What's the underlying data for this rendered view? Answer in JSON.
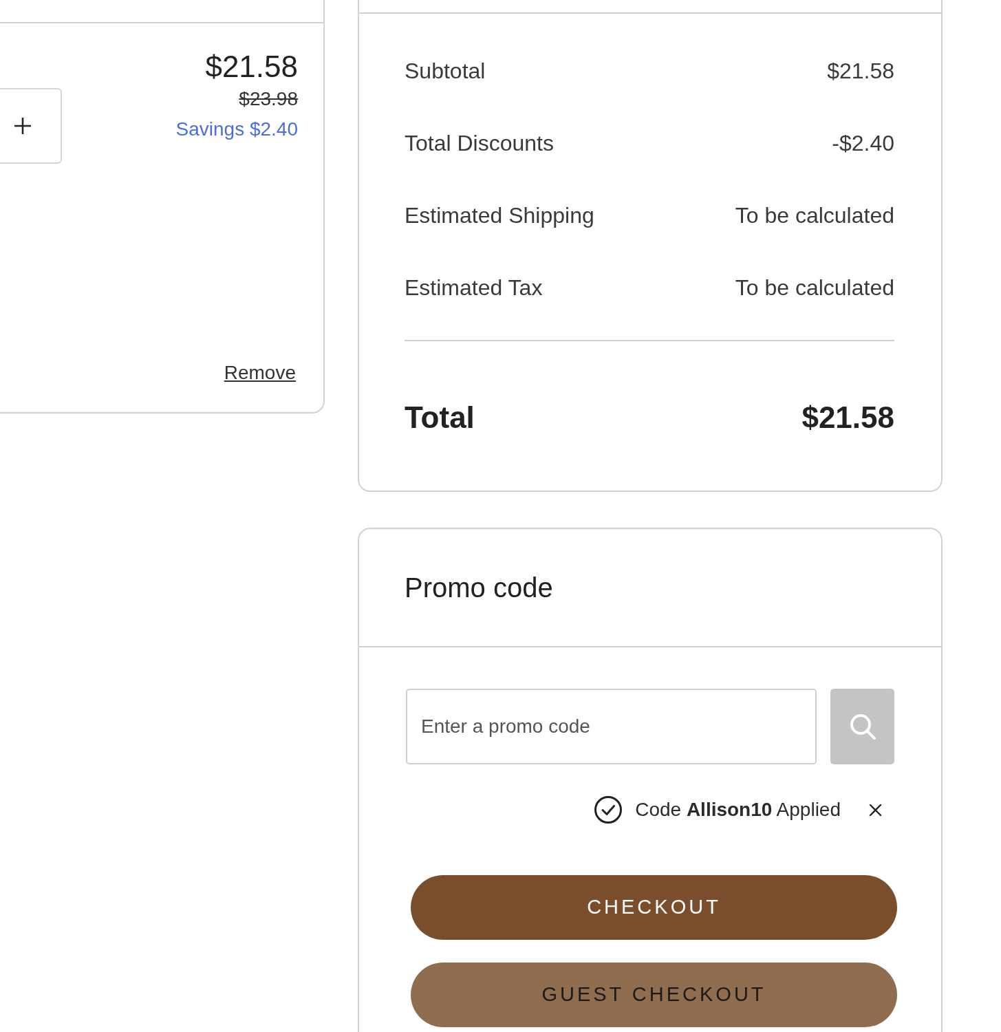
{
  "cart_item": {
    "price": "$21.58",
    "original_price": "$23.98",
    "savings": "Savings $2.40",
    "remove_link": "Remove"
  },
  "order_summary": {
    "rows": [
      {
        "label": "Subtotal",
        "value": "$21.58"
      },
      {
        "label": "Total Discounts",
        "value": "-$2.40"
      },
      {
        "label": "Estimated Shipping",
        "value": "To be calculated"
      },
      {
        "label": "Estimated Tax",
        "value": "To be calculated"
      }
    ],
    "total": {
      "label": "Total",
      "value": "$21.58"
    }
  },
  "promo": {
    "title": "Promo code",
    "input": {
      "placeholder": "Enter a promo code"
    },
    "applied_message": "Code **Allison10** Applied"
  },
  "buttons": [
    {
      "label": "CHECKOUT",
      "kind": "primary"
    },
    {
      "label": "GUEST CHECKOUT",
      "kind": "secondary"
    }
  ]
}
